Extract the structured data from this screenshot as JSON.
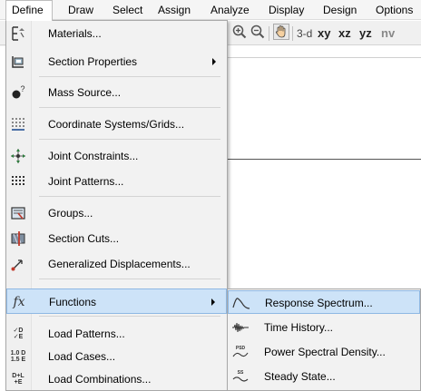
{
  "menubar": {
    "items": [
      {
        "label": "Define",
        "active": true
      },
      {
        "label": "Draw",
        "active": false
      },
      {
        "label": "Select",
        "active": false
      },
      {
        "label": "Assign",
        "active": false
      },
      {
        "label": "Analyze",
        "active": false
      },
      {
        "label": "Display",
        "active": false
      },
      {
        "label": "Design",
        "active": false
      },
      {
        "label": "Options",
        "active": false
      }
    ]
  },
  "toolbar": {
    "zoom_in_icon": "zoom-in-icon",
    "zoom_out_icon": "zoom-out-icon",
    "pan_icon": "pan-hand-icon",
    "view_3d": "3-d",
    "view_xy": "xy",
    "view_xz": "xz",
    "view_yz": "yz",
    "view_nv": "nv"
  },
  "define_menu": {
    "items": [
      {
        "label": "Materials...",
        "icon": "materials-icon",
        "submenu": false
      },
      {
        "label": "Section Properties",
        "icon": "section-properties-icon",
        "submenu": true
      },
      {
        "label": "Mass Source...",
        "icon": "mass-source-icon",
        "submenu": false
      },
      {
        "label": "Coordinate Systems/Grids...",
        "icon": "grid-icon",
        "submenu": false
      },
      {
        "label": "Joint Constraints...",
        "icon": "joint-constraints-icon",
        "submenu": false
      },
      {
        "label": "Joint Patterns...",
        "icon": "joint-patterns-icon",
        "submenu": false
      },
      {
        "label": "Groups...",
        "icon": "groups-icon",
        "submenu": false
      },
      {
        "label": "Section Cuts...",
        "icon": "section-cuts-icon",
        "submenu": false
      },
      {
        "label": "Generalized Displacements...",
        "icon": "generalized-displacements-icon",
        "submenu": false
      },
      {
        "label": "Functions",
        "icon": "functions-icon",
        "submenu": true,
        "highlighted": true
      },
      {
        "label": "Load Patterns...",
        "icon": "load-patterns-icon",
        "submenu": false
      },
      {
        "label": "Load Cases...",
        "icon": "load-cases-icon",
        "submenu": false
      },
      {
        "label": "Load Combinations...",
        "icon": "load-combinations-icon",
        "submenu": false
      }
    ],
    "icon_text": {
      "functions": "fx",
      "load_patterns_top": "✓D",
      "load_patterns_bottom": "✓E",
      "load_cases_top": "1.0 D",
      "load_cases_bottom": "1.5 E",
      "load_combinations_top": "D+L",
      "load_combinations_bottom": "+E"
    }
  },
  "functions_submenu": {
    "items": [
      {
        "label": "Response Spectrum...",
        "icon": "response-spectrum-icon",
        "highlighted": true
      },
      {
        "label": "Time History...",
        "icon": "time-history-icon"
      },
      {
        "label": "Power Spectral Density...",
        "icon": "power-spectral-density-icon",
        "badge": "PSD"
      },
      {
        "label": "Steady State...",
        "icon": "steady-state-icon",
        "badge": "SS"
      }
    ]
  },
  "colors": {
    "highlight_bg": "#cde3f8",
    "highlight_border": "#8fb8e3",
    "menu_bg": "#f2f2f2"
  }
}
